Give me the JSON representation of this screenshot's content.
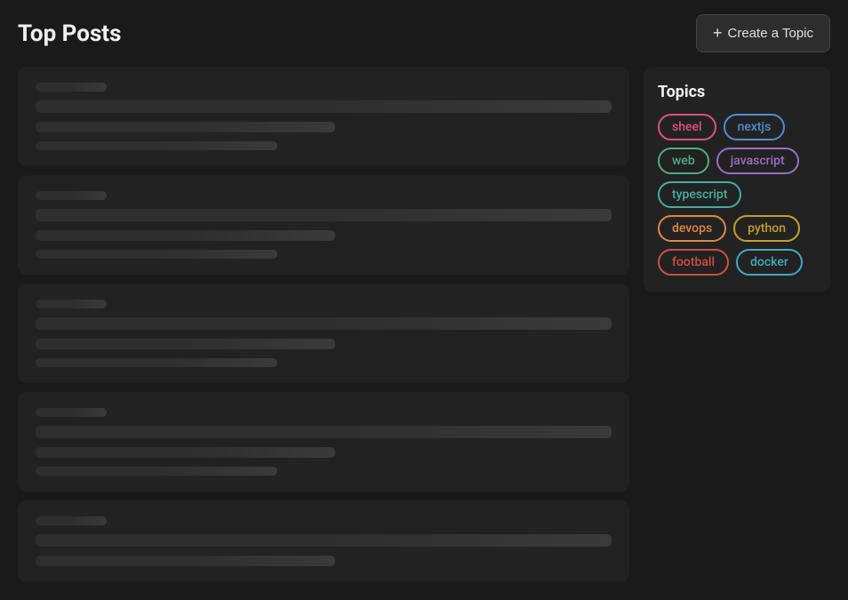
{
  "header": {
    "title": "Top Posts",
    "create_button_label": "Create a Topic",
    "plus_icon": "+"
  },
  "sidebar": {
    "topics_title": "Topics",
    "topics": [
      {
        "label": "sheel",
        "color_class": "pink"
      },
      {
        "label": "nextjs",
        "color_class": "blue"
      },
      {
        "label": "web",
        "color_class": "green"
      },
      {
        "label": "javascript",
        "color_class": "purple"
      },
      {
        "label": "typescript",
        "color_class": "teal"
      },
      {
        "label": "devops",
        "color_class": "orange"
      },
      {
        "label": "python",
        "color_class": "yellow"
      },
      {
        "label": "football",
        "color_class": "red"
      },
      {
        "label": "docker",
        "color_class": "cyan"
      }
    ]
  },
  "posts": [
    {
      "id": 1
    },
    {
      "id": 2
    },
    {
      "id": 3
    },
    {
      "id": 4
    },
    {
      "id": 5
    }
  ]
}
